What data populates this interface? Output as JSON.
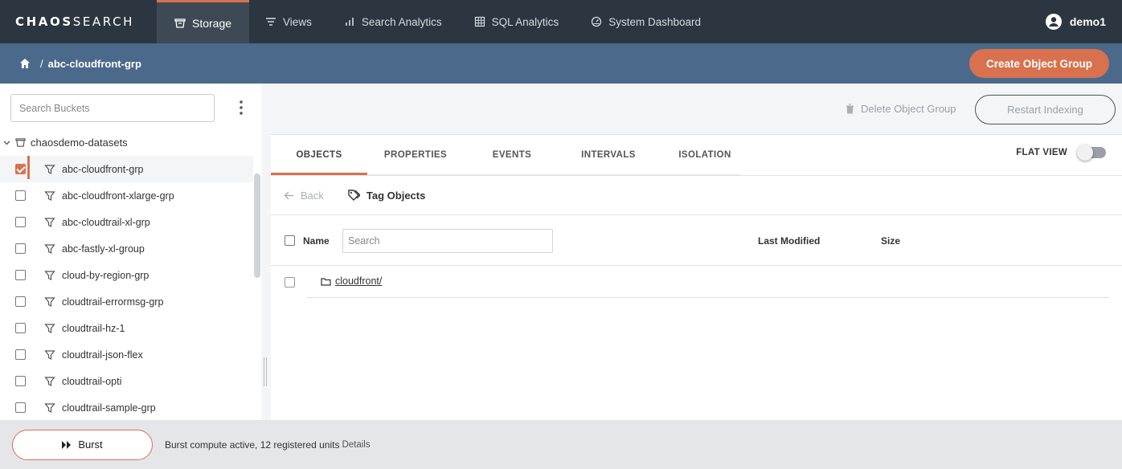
{
  "brand": {
    "logo_bold": "CHAOS",
    "logo_thin": "SEARCH"
  },
  "nav": {
    "items": [
      {
        "label": "Storage",
        "icon": "storage-icon",
        "active": true
      },
      {
        "label": "Views",
        "icon": "filter-lines-icon"
      },
      {
        "label": "Search Analytics",
        "icon": "bar-chart-icon"
      },
      {
        "label": "SQL Analytics",
        "icon": "grid-icon"
      },
      {
        "label": "System Dashboard",
        "icon": "dashboard-icon"
      }
    ],
    "user": "demo1"
  },
  "breadcrumb": {
    "separator": "/",
    "current": "abc-cloudfront-grp"
  },
  "header": {
    "create_label": "Create Object Group"
  },
  "sidebar": {
    "search_placeholder": "Search Buckets",
    "root": "chaosdemo-datasets",
    "items": [
      {
        "label": "abc-cloudfront-grp",
        "checked": true
      },
      {
        "label": "abc-cloudfront-xlarge-grp"
      },
      {
        "label": "abc-cloudtrail-xl-grp"
      },
      {
        "label": "abc-fastly-xl-group"
      },
      {
        "label": "cloud-by-region-grp"
      },
      {
        "label": "cloudtrail-errormsg-grp"
      },
      {
        "label": "cloudtrail-hz-1"
      },
      {
        "label": "cloudtrail-json-flex"
      },
      {
        "label": "cloudtrail-opti"
      },
      {
        "label": "cloudtrail-sample-grp"
      }
    ]
  },
  "actions": {
    "delete_label": "Delete Object Group",
    "restart_label": "Restart Indexing"
  },
  "tabs": [
    {
      "label": "OBJECTS",
      "active": true
    },
    {
      "label": "PROPERTIES"
    },
    {
      "label": "EVENTS"
    },
    {
      "label": "INTERVALS"
    },
    {
      "label": "ISOLATION"
    }
  ],
  "flat_view": {
    "label": "FLAT VIEW",
    "on": false
  },
  "toolbar": {
    "back_label": "Back",
    "tag_label": "Tag Objects"
  },
  "table": {
    "headers": {
      "name": "Name",
      "modified": "Last Modified",
      "size": "Size"
    },
    "search_placeholder": "Search",
    "rows": [
      {
        "name": "cloudfront/"
      }
    ]
  },
  "footer": {
    "burst_label": "Burst",
    "status": "Burst compute active, 12 registered units",
    "details": "Details"
  },
  "colors": {
    "accent": "#d9714f",
    "nav_bg": "#2b3640",
    "subheader_bg": "#4b6a8b"
  }
}
